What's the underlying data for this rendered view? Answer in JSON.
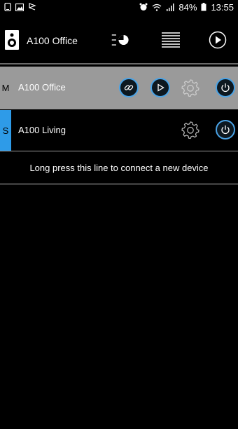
{
  "status_bar": {
    "battery": "84%",
    "time": "13:55"
  },
  "header": {
    "device_name": "A100 Office"
  },
  "devices": [
    {
      "role": "M",
      "name": "A100 Office"
    },
    {
      "role": "S",
      "name": "A100 Living"
    }
  ],
  "connect_hint": "Long press this line to connect a new device",
  "colors": {
    "accent": "#2e9be8",
    "master_row_bg": "#9a9a9a",
    "background": "#000000"
  },
  "icons": {
    "header": [
      "speaker-icon",
      "volume-list-icon",
      "queue-list-icon",
      "play-circle-icon"
    ],
    "master_row": [
      "link-icon",
      "play-icon",
      "settings-gear-icon",
      "power-icon"
    ],
    "slave_row": [
      "settings-gear-icon",
      "power-icon"
    ]
  }
}
